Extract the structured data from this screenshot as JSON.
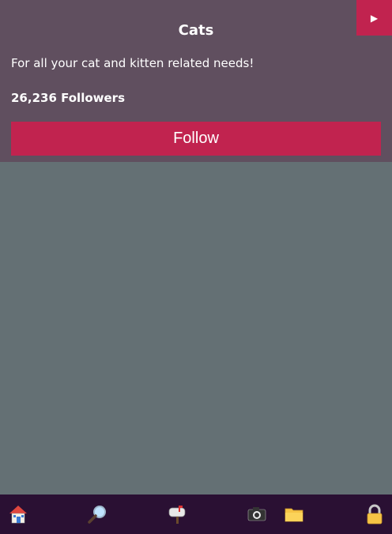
{
  "header": {
    "title": "Cats",
    "description": "For all your cat and kitten related needs!",
    "followers": "26,236 Followers",
    "follow_label": "Follow",
    "play_icon": "play-icon"
  },
  "bottom_nav": {
    "items": [
      {
        "icon": "home-icon"
      },
      {
        "icon": "search-icon"
      },
      {
        "icon": "mailbox-icon"
      },
      {
        "icon": "camera-icon"
      },
      {
        "icon": "folder-icon"
      },
      {
        "icon": "lock-icon"
      }
    ]
  },
  "colors": {
    "header_bg": "#604f5f",
    "accent": "#c1234f",
    "content_bg": "#647074",
    "nav_bg": "#2a1033"
  }
}
